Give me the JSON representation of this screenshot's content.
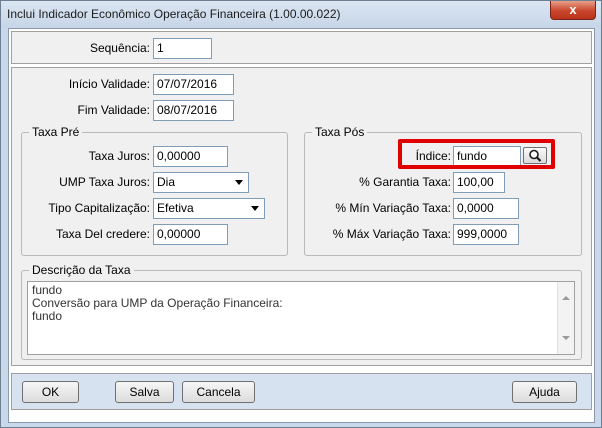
{
  "window": {
    "title": "Inclui Indicador Econômico Operação Financeira (1.00.00.022)",
    "close_label": "x"
  },
  "form": {
    "sequencia": {
      "label": "Sequência:",
      "value": "1"
    },
    "inicio_validade": {
      "label": "Início Validade:",
      "value": "07/07/2016"
    },
    "fim_validade": {
      "label": "Fim Validade:",
      "value": "08/07/2016"
    },
    "taxa_pre": {
      "legend": "Taxa Pré",
      "taxa_juros": {
        "label": "Taxa Juros:",
        "value": "0,00000"
      },
      "ump_taxa_juros": {
        "label": "UMP Taxa Juros:",
        "value": "Dia"
      },
      "tipo_capitalizacao": {
        "label": "Tipo Capitalização:",
        "value": "Efetiva"
      },
      "taxa_del_credere": {
        "label": "Taxa Del credere:",
        "value": "0,00000"
      }
    },
    "taxa_pos": {
      "legend": "Taxa Pós",
      "indice": {
        "label": "Índice:",
        "value": "fundo"
      },
      "garantia_taxa": {
        "label": "% Garantia Taxa:",
        "value": "100,00"
      },
      "min_variacao_taxa": {
        "label": "% Mín Variação Taxa:",
        "value": "0,0000"
      },
      "max_variacao_taxa": {
        "label": "% Máx Variação Taxa:",
        "value": "999,0000"
      }
    },
    "descricao": {
      "legend": "Descrição da Taxa",
      "lines": [
        "fundo",
        "Conversão para UMP da Operação Financeira:",
        "fundo"
      ]
    }
  },
  "buttons": {
    "ok": "OK",
    "salva": "Salva",
    "cancela": "Cancela",
    "ajuda": "Ajuda"
  },
  "icons": {
    "search": "magnifier-icon",
    "close": "close-icon"
  },
  "colors": {
    "highlight": "#e00000",
    "close_button": "#c8452b"
  }
}
